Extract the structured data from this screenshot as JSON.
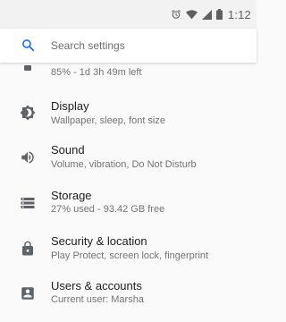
{
  "status_bar": {
    "time": "1:12",
    "icons": [
      "alarm-icon",
      "wifi-icon",
      "signal-icon",
      "battery-icon"
    ]
  },
  "search": {
    "placeholder": "Search settings",
    "icon": "search-icon"
  },
  "settings": {
    "battery": {
      "summary": "85% - 1d 3h 49m left",
      "icon": "battery-icon"
    },
    "items": [
      {
        "title": "Display",
        "summary": "Wallpaper, sleep, font size",
        "icon": "brightness-icon"
      },
      {
        "title": "Sound",
        "summary": "Volume, vibration, Do Not Disturb",
        "icon": "volume-icon"
      },
      {
        "title": "Storage",
        "summary": "27% used - 93.42 GB free",
        "icon": "storage-icon"
      },
      {
        "title": "Security & location",
        "summary": "Play Protect, screen lock, fingerprint",
        "icon": "lock-icon"
      },
      {
        "title": "Users & accounts",
        "summary": "Current user: Marsha",
        "icon": "account-icon"
      }
    ]
  },
  "colors": {
    "accent": "#1a73e8",
    "icon": "#5f6368",
    "title_text": "#212121",
    "summary_text": "#737373"
  }
}
